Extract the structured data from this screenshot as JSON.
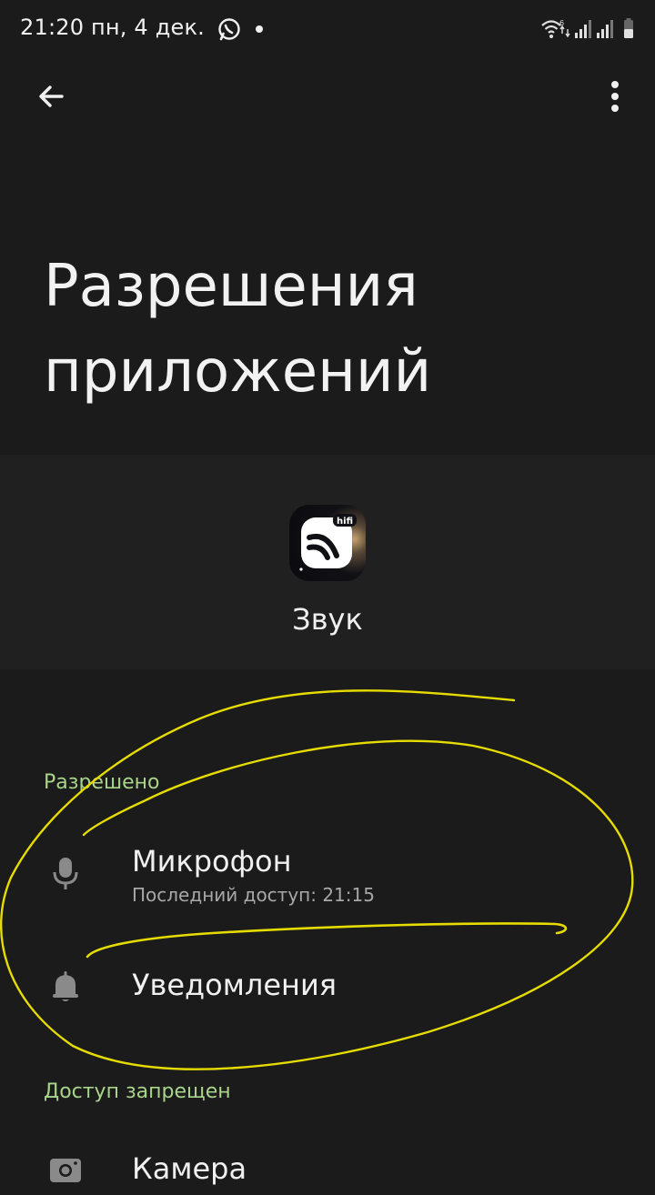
{
  "status_bar": {
    "text": "21:20  пн, 4 дек.",
    "icons": [
      "whatsapp-icon",
      "notification-dot",
      "wifi-icon",
      "signal-icon",
      "signal-icon",
      "battery-icon"
    ]
  },
  "toolbar": {
    "back_icon": "arrow-left-icon",
    "more_icon": "more-vertical-icon"
  },
  "header": {
    "title": "Разрешения\nприложений"
  },
  "app": {
    "name": "Звук",
    "icon_badge": "hifi"
  },
  "permissions": {
    "allowed_header": "Разрешено",
    "allowed": [
      {
        "label": "Микрофон",
        "sub": "Последний доступ: 21:15",
        "icon": "microphone-icon"
      },
      {
        "label": "Уведомления",
        "sub": "",
        "icon": "bell-icon"
      }
    ],
    "denied_header": "Доступ запрещен",
    "denied": [
      {
        "label": "Камера",
        "sub": "",
        "icon": "camera-icon"
      }
    ]
  },
  "colors": {
    "background": "#1b1b1b",
    "card": "#202020",
    "section_header": "#a9d58b",
    "annotation": "#e6dc00"
  }
}
